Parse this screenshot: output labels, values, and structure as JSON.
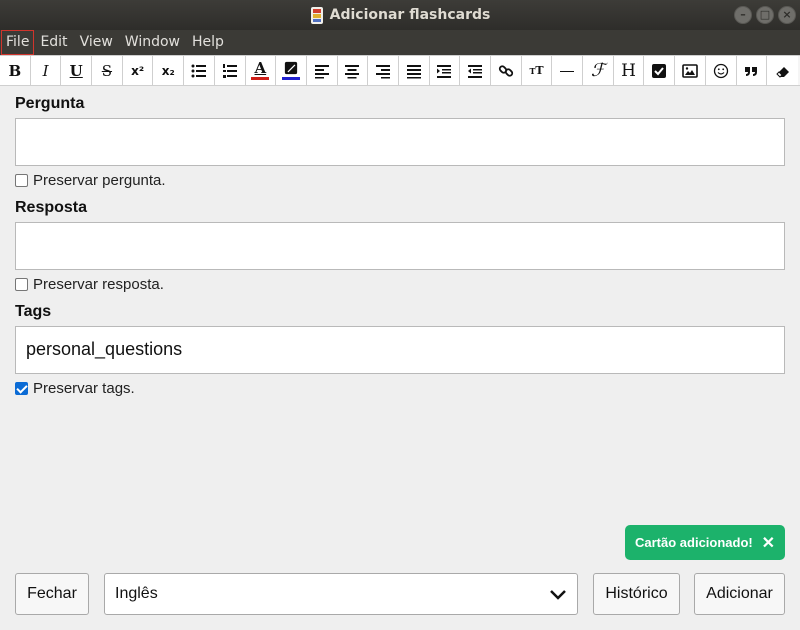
{
  "window": {
    "title": "Adicionar flashcards"
  },
  "menu": [
    {
      "label": "File",
      "active": true
    },
    {
      "label": "Edit"
    },
    {
      "label": "View"
    },
    {
      "label": "Window"
    },
    {
      "label": "Help"
    }
  ],
  "toolbar": {
    "bold": "B",
    "italic": "I",
    "underline": "U",
    "strike": "S",
    "superscript": "x²",
    "subscript": "x₂",
    "heading": "H",
    "text_color": "A",
    "text_color_value": "#d0201a",
    "highlight_color_value": "#2020d0"
  },
  "fields": {
    "question": {
      "label": "Pergunta",
      "value": "",
      "preserve_label": "Preservar pergunta.",
      "preserve_checked": false
    },
    "answer": {
      "label": "Resposta",
      "value": "",
      "preserve_label": "Preservar resposta.",
      "preserve_checked": false
    },
    "tags": {
      "label": "Tags",
      "value": "personal_questions",
      "preserve_label": "Preservar tags.",
      "preserve_checked": true
    }
  },
  "toast": {
    "message": "Cartão adicionado!",
    "close": "✕"
  },
  "bottom": {
    "close_label": "Fechar",
    "deck_selected": "Inglês",
    "history_label": "Histórico",
    "add_label": "Adicionar"
  }
}
